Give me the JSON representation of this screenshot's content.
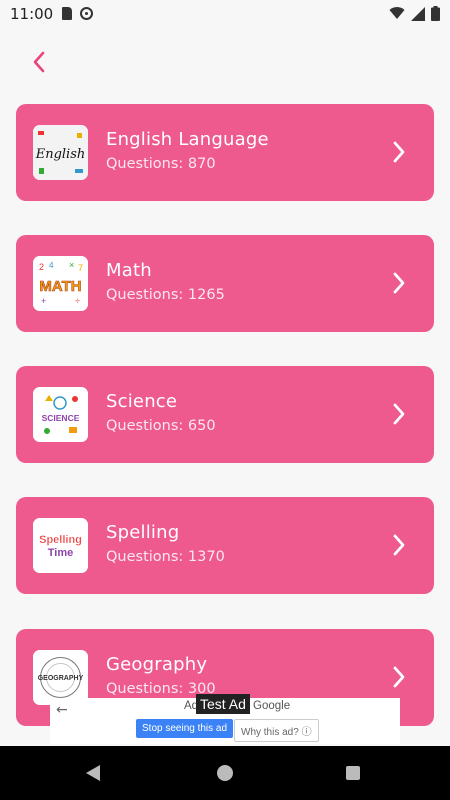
{
  "status_bar": {
    "time": "11:00",
    "icons": [
      "sd-card-icon",
      "at-sign-icon",
      "wifi-icon",
      "signal-icon",
      "battery-icon"
    ]
  },
  "header": {
    "back_icon": "chevron-left-icon",
    "accent_color": "#e8447f"
  },
  "subjects": [
    {
      "title": "English Language",
      "questions": "Questions: 870",
      "icon": "english-thumbnail"
    },
    {
      "title": "Math",
      "questions": "Questions: 1265",
      "icon": "math-thumbnail"
    },
    {
      "title": "Science",
      "questions": "Questions: 650",
      "icon": "science-thumbnail"
    },
    {
      "title": "Spelling",
      "questions": "Questions: 1370",
      "icon": "spelling-time-thumbnail"
    },
    {
      "title": "Geography",
      "questions": "Questions: 300",
      "icon": "geography-thumbnail"
    }
  ],
  "card_color": "#ee5a8d",
  "ad": {
    "test_label": "Test Ad",
    "closed_text": "Ad closed by Google",
    "stop_button": "Stop seeing this ad",
    "why_button": "Why this ad? ⓘ"
  },
  "thumbs": {
    "english_text": "English",
    "math_text": "MATH",
    "science_text": "SCIENCE",
    "spelling_line1": "Spelling",
    "spelling_line2": "Time",
    "geography_text": "GEOGRAPHY"
  }
}
